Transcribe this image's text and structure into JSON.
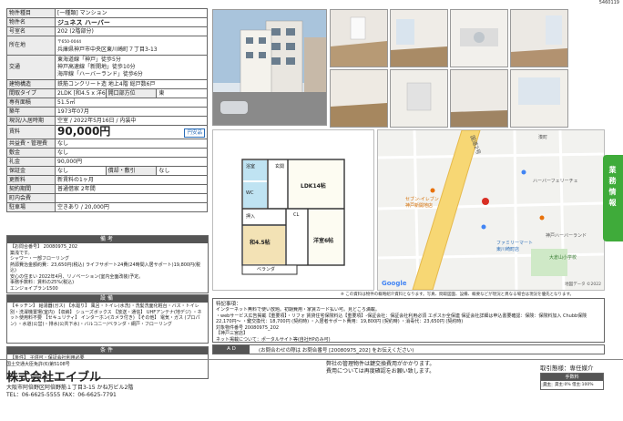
{
  "doc_id": "5460119",
  "specs": {
    "type_label": "物件種目",
    "type_value": "[一種類] マンション",
    "name_label": "物件名",
    "name_value": "ジュネス ハーバー",
    "room_label": "号室名",
    "room_value": "202 (2階部分)",
    "addr_label": "所在地",
    "addr_postal": "〒650-0044",
    "addr_value": "兵庫県神戸市中央区東川崎町７丁目3-13",
    "traffic_label": "交通",
    "traffic_lines": [
      "東海道線「神戸」徒歩5分",
      "神戸高速線「新開地」徒歩10分",
      "海岸線「ハーバーランド」徒歩6分"
    ],
    "struct_label": "建物構造",
    "struct_value": "鉄筋コンクリート造 地上4階 総戸数6戸",
    "layout_label": "間取タイプ",
    "layout_value": "2LDK [和4.5 x 洋6 x LDK14]",
    "window_label": "開口部方位",
    "window_value": "東",
    "area_label": "専有面積",
    "area_value": "51.5㎡",
    "age_label": "築年",
    "age_value": "1973年07月",
    "status_label": "現況/入居時期",
    "status_value": "空室 / 2022年5月16日 / 内装中",
    "rent_label": "賃料",
    "rent_value": "90,000円",
    "rent_badge": "円安品",
    "fee_label": "共益費・管理費",
    "fee_value": "なし",
    "deposit_label": "敷金",
    "deposit_value": "なし",
    "key_label": "礼金",
    "key_value": "90,000円",
    "guarantee_label": "保証金",
    "guarantee_value": "なし",
    "amort_label": "償却・敷引",
    "amort_value": "なし",
    "renew_label": "更新料",
    "renew_value": "新賃料の1ヶ月",
    "contract_label": "契約期間",
    "contract_value": "普通借家 2年間",
    "town_label": "町内会費",
    "town_value": "",
    "parking_label": "駐車場",
    "parking_value": "空きあり / 20,000円"
  },
  "remarks": {
    "header": "備考",
    "text": "【お問合番号】 20080975_202\n築浅です。\nシャワー・一部フローリング\n熱源費治金額約費：23,650円(税込) ライフサポート24費(24時間入居サポート)19,800円(税込)\n安心の住まい 2022年4月、リノベーション(室内全面改装)予定。\n事務手数料：賃料の25%(税込)\nエンジョイプラン1500"
  },
  "equipment": {
    "header": "設備",
    "text": "【キッチン】 給湯器(ガス) 【水廻り】 風呂・トイレ(水洗)・洗髪洗面化粧台・バス・トイレ別・洗濯機置場(室内) 【収納】 シューズボックス 【放送・通信】 UHFアンテナ(地デジ) ・ネット使用料不要 【セキュリティ】 インターホン(カメラ付き) 【その他】 電気・ガス (プロパン) ・水道(公営)・排水(公共下水)・バルコニー/ベランダ・網戸・フローリング"
  },
  "conditions": {
    "header": "条件",
    "text": "【条件】 子供可・保証会社利用必要"
  },
  "floorplan": {
    "rooms": {
      "ldk": "LDK14帖",
      "washitsu": "和4.5帖",
      "yoshitsu": "洋室6帖",
      "entry": "玄関",
      "bath": "浴室",
      "veranda": "ベランダ",
      "closet": "押入",
      "closet2": "CL",
      "wc": "WC"
    }
  },
  "map": {
    "labels": [
      "セブン-イレブン",
      "神戸新開地店",
      "ハーバーフェリーチェ",
      "ファミリーマート",
      "東川崎町店",
      "大倉山小学校",
      "神戸ハーバーランド",
      "湊町",
      "Google"
    ],
    "road_label": "国道2号",
    "attribution": "地図データ ©2022"
  },
  "disclaimer": "※ この資料は物件の概略紹介資料となります。写真、間取図面、設備、概要などが現況と異なる場合は現況を優先となります。",
  "special": {
    "title": "特記事項：",
    "text": "インターネット無料で使い放題。初期費用・家賃カード払い可。見どころ満載。\n・webサービス広告掲載【重要項】・リフォ 賃貸住宅保険料込【重要項】-保証会社：保証会社利用必須 エポスか全保連 保証会社詳細は申込書要確認：保険：保険料加入 Chubb保険 22,170円～ ・鍵交換代：18,700円 (契約時) ・入居者サポート費用：19,800円 (契約時) ・消毒代：23,650円 (契約時)\n対象物件番号 20080975_202\n【神戸三宮店】\nネット掲載について：ポータルサイト等(自社HPのみ可)\n■ カギ所在：神戸三宮店 物件コード(20080975_202) 【注1】弊社より担当店舗へ鍵手配します(※遠隔店舗に連絡願え)、注2)鍵の貸出はご連絡をいただいた時間より時間内(※※重要事項内容期間)、注3)東内の際の駐車場は付近のコインパーキングを使用すること(敷地内駐車場厳禁等注意事項)"
  },
  "ad_row": {
    "label": "A D",
    "text": "(お問合わせの際は お問合番号 [20080975_202] をお伝えください)"
  },
  "company": {
    "license": "国土交通大臣免許(6)第5108号",
    "name": "株式会社エイブル",
    "address": "大阪市阿倍野区阿倍野筋１丁目3-15 かね万ビル2階",
    "phone_line": "TEL：06-6625-5555  FAX：06-6625-7791"
  },
  "footer_notice": {
    "line1": "弊社の管理物件は鍵交換費用がかかります。",
    "line2": "費用については再度確認をお願い致します。"
  },
  "commission": {
    "title": "取引態様：専任媒介",
    "header": "手数料",
    "row_label": "貸主",
    "row_value": "貸主:0%  借主:100%"
  },
  "side_tab": "業務情報"
}
